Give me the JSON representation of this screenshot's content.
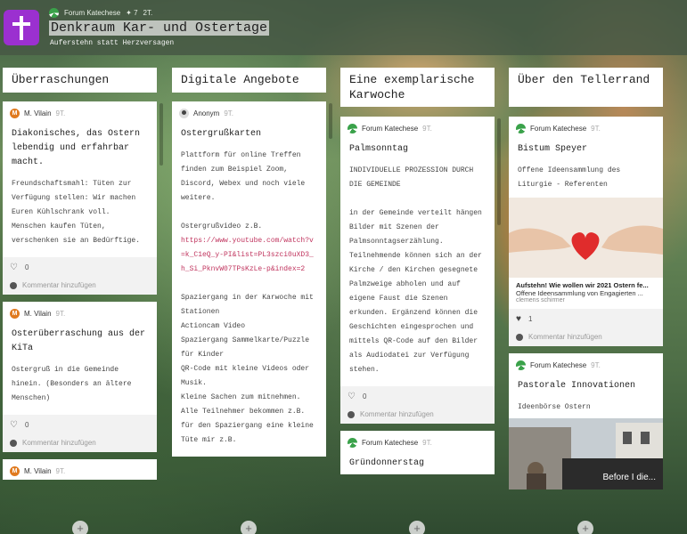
{
  "header": {
    "author": "Forum Katechese",
    "likes": "✦ 7",
    "age": "2T.",
    "title": "Denkraum Kar- und Ostertage",
    "subtitle": "Auferstehn statt Herzversagen"
  },
  "columns": [
    {
      "title": "Überraschungen",
      "cards": [
        {
          "author": "M. Vilain",
          "avatar_letter": "M",
          "time": "9T.",
          "title": "Diakonisches, das Ostern lebendig und erfahrbar macht.",
          "body": "Freundschaftsmahl: Tüten zur Verfügung stellen: Wir machen Euren Kühlschrank voll. Menschen kaufen Tüten, verschenken sie an Bedürftige.",
          "likes": "0",
          "comment": "Kommentar hinzufügen"
        },
        {
          "author": "M. Vilain",
          "avatar_letter": "M",
          "time": "9T.",
          "title": "Osterüberraschung aus der KiTa",
          "body": "Ostergruß in die Gemeinde hinein. (Besonders an ältere Menschen)",
          "likes": "0",
          "comment": "Kommentar hinzufügen"
        },
        {
          "author": "M. Vilain",
          "avatar_letter": "M",
          "time": "9T."
        }
      ]
    },
    {
      "title": "Digitale Angebote",
      "cards": [
        {
          "author": "Anonym",
          "time": "9T.",
          "title": "Ostergrußkarten",
          "body1": "Plattform für online Treffen finden zum Beispiel Zoom, Discord, Webex und noch viele weitere.\n\nOstergrußvideo z.B.",
          "link": "https://www.youtube.com/watch?v=k_C1eQ_y-PI&list=PL3szci0uXD3_h_Si_PknvW07TPsKzLe-p&index=2",
          "body2": "Spaziergang in der Karwoche mit Stationen\nActioncam Video\nSpaziergang Sammelkarte/Puzzle für Kinder\nQR-Code mit kleine Videos oder Musik.\nKleine Sachen zum mitnehmen.\nAlle Teilnehmer bekommen z.B. für den Spaziergang eine kleine Tüte mir z.B."
        }
      ]
    },
    {
      "title": "Eine exemplarische Karwoche",
      "cards": [
        {
          "author": "Forum Katechese",
          "time": "9T.",
          "title": "Palmsonntag",
          "body": "INDIVIDUELLE PROZESSION DURCH DIE GEMEINDE\n\nin der Gemeinde verteilt hängen Bilder mit Szenen der Palmsonntagserzählung. Teilnehmende können sich an der Kirche / den Kirchen gesegnete Palmzweige abholen und auf eigene Faust die Szenen erkunden. Ergänzend können die Geschichten eingesprochen und mittels QR-Code auf den Bilder als Audiodatei zur Verfügung stehen.",
          "likes": "0",
          "comment": "Kommentar hinzufügen"
        },
        {
          "author": "Forum Katechese",
          "time": "9T.",
          "title": "Gründonnerstag"
        }
      ]
    },
    {
      "title": "Über den Tellerrand",
      "cards": [
        {
          "author": "Forum Katechese",
          "time": "9T.",
          "title": "Bistum Speyer",
          "body": "Offene Ideensammlung des Liturgie - Referenten",
          "link_title": "Aufstehn! Wie wollen wir 2021 Ostern fe...",
          "link_desc": "Offene Ideensammlung von Engagierten ...",
          "link_author": "clemens schirmer",
          "likes": "1",
          "comment": "Kommentar hinzufügen"
        },
        {
          "author": "Forum Katechese",
          "time": "9T.",
          "title": "Pastorale Innovationen",
          "body": "Ideenbörse Ostern",
          "image_text": "Before I die..."
        }
      ]
    }
  ],
  "add_label": "+"
}
